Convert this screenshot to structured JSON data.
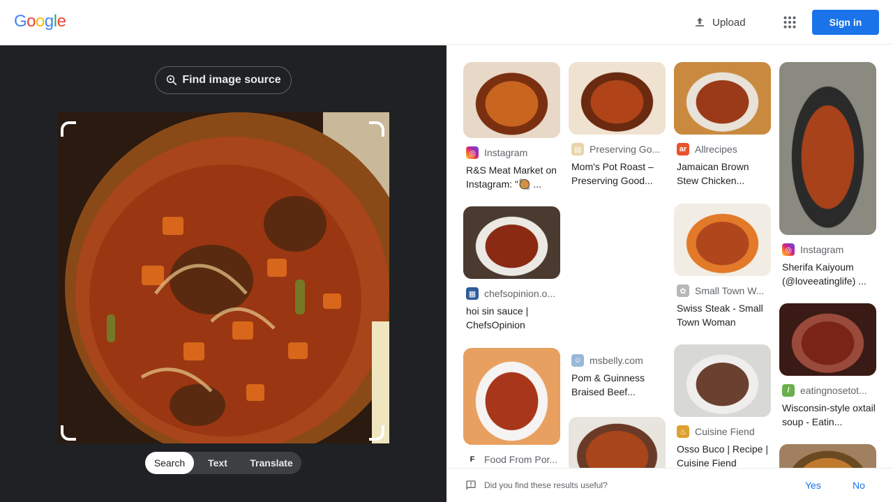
{
  "header": {
    "logo_letters": [
      "G",
      "o",
      "o",
      "g",
      "l",
      "e"
    ],
    "logo_colors": [
      "#4285F4",
      "#EA4335",
      "#FBBC05",
      "#4285F4",
      "#34A853",
      "#EA4335"
    ],
    "upload_label": "Upload",
    "signin_label": "Sign in",
    "brand_color": "#1a73e8"
  },
  "left_panel": {
    "find_source_label": "Find image source",
    "modes": [
      "Search",
      "Text",
      "Translate"
    ],
    "active_mode": "Search"
  },
  "results": [
    {
      "source": "Instagram",
      "title": "R&S Meat Market on Instagram: \"🥘 ...",
      "icon": "instagram-icon"
    },
    {
      "source": "Preserving Go...",
      "title": "Mom's Pot Roast – Preserving Good...",
      "icon": "preserving-icon"
    },
    {
      "source": "Allrecipes",
      "title": "Jamaican Brown Stew Chicken...",
      "icon": "allrecipes-icon"
    },
    {
      "source": "Instagram",
      "title": "Sherifa Kaiyoum (@loveeatinglife) ...",
      "icon": "instagram-icon"
    },
    {
      "source": "chefsopinion.o...",
      "title": "hoi sin sauce | ChefsOpinion",
      "icon": "chefsopinion-icon"
    },
    {
      "source": "Small Town W...",
      "title": "Swiss Steak - Small Town Woman",
      "icon": "smalltown-icon"
    },
    {
      "source": "msbelly.com",
      "title": "Pom & Guinness Braised Beef...",
      "icon": "msbelly-icon"
    },
    {
      "source": "eatingnosetot...",
      "title": "Wisconsin-style oxtail soup - Eatin...",
      "icon": "eatingnose-icon"
    },
    {
      "source": "Cuisine Fiend",
      "title": "Osso Buco | Recipe | Cuisine Fiend",
      "icon": "cuisinefiend-icon"
    },
    {
      "source": "Food From Por...",
      "title": "",
      "icon": "foodfrom-icon"
    }
  ],
  "feedback": {
    "question": "Did you find these results useful?",
    "yes_label": "Yes",
    "no_label": "No"
  }
}
